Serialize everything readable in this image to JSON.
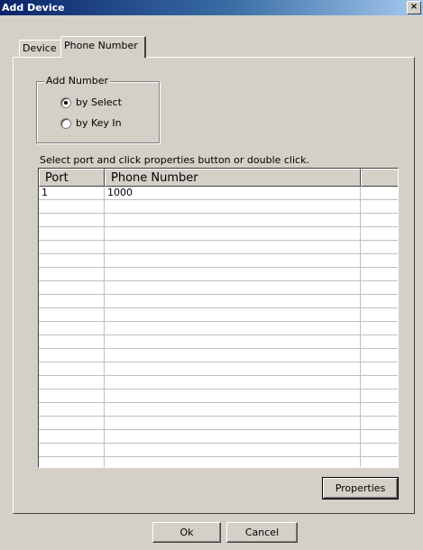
{
  "window": {
    "title": "Add Device",
    "close_glyph": "×"
  },
  "tabs": [
    {
      "label": "Device",
      "active": false
    },
    {
      "label": "Phone Number",
      "active": true
    }
  ],
  "add_number": {
    "legend": "Add Number",
    "options": [
      {
        "label": "by Select",
        "checked": true
      },
      {
        "label": "by Key In",
        "checked": false
      }
    ]
  },
  "instruction": "Select port and click properties button or double click.",
  "table": {
    "columns": [
      "Port",
      "Phone Number",
      ""
    ],
    "rows": [
      {
        "port": "1",
        "phone": "1000"
      }
    ],
    "empty_rows": 20
  },
  "buttons": {
    "properties": "Properties",
    "ok": "Ok",
    "cancel": "Cancel"
  }
}
